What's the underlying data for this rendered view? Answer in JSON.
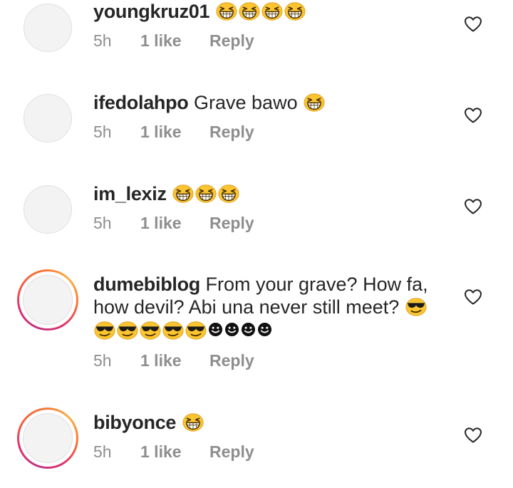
{
  "comments": [
    {
      "username": "youngkruz01",
      "text": "",
      "emojis": [
        "grinning-squinting-face",
        "grinning-squinting-face",
        "grinning-squinting-face",
        "grinning-squinting-face"
      ],
      "time": "5h",
      "likes": "1 like",
      "reply": "Reply",
      "avatar_story_ring": false
    },
    {
      "username": "ifedolahpo",
      "text": "Grave bawo",
      "emojis": [
        "grinning-squinting-face"
      ],
      "time": "5h",
      "likes": "1 like",
      "reply": "Reply",
      "avatar_story_ring": false
    },
    {
      "username": "im_lexiz",
      "text": "",
      "emojis": [
        "grinning-squinting-face",
        "grinning-squinting-face",
        "grinning-squinting-face"
      ],
      "time": "5h",
      "likes": "1 like",
      "reply": "Reply",
      "avatar_story_ring": false
    },
    {
      "username": "dumebiblog",
      "text_line1": "From your grave? How fa,",
      "text_line2": "how devil? Abi una never still meet?",
      "emojis_line2": [
        "smiling-face-with-sunglasses"
      ],
      "emojis_line3": [
        "smiling-face-with-sunglasses",
        "smiling-face-with-sunglasses",
        "smiling-face-with-sunglasses",
        "smiling-face-with-sunglasses",
        "smiling-face-with-sunglasses",
        "black-smiling-face",
        "black-smiling-face",
        "black-smiling-face",
        "black-smiling-face"
      ],
      "time": "5h",
      "likes": "1 like",
      "reply": "Reply",
      "avatar_story_ring": true
    },
    {
      "username": "bibyonce",
      "text": "",
      "emojis": [
        "grinning-squinting-face"
      ],
      "time": "5h",
      "likes": "1 like",
      "reply": "Reply",
      "avatar_story_ring": true
    }
  ],
  "colors": {
    "username": "#262626",
    "meta": "#8e8e8e",
    "emoji_yellow": "#fbc531",
    "story_ring_start": "#c13584",
    "story_ring_end": "#fcaf45"
  }
}
